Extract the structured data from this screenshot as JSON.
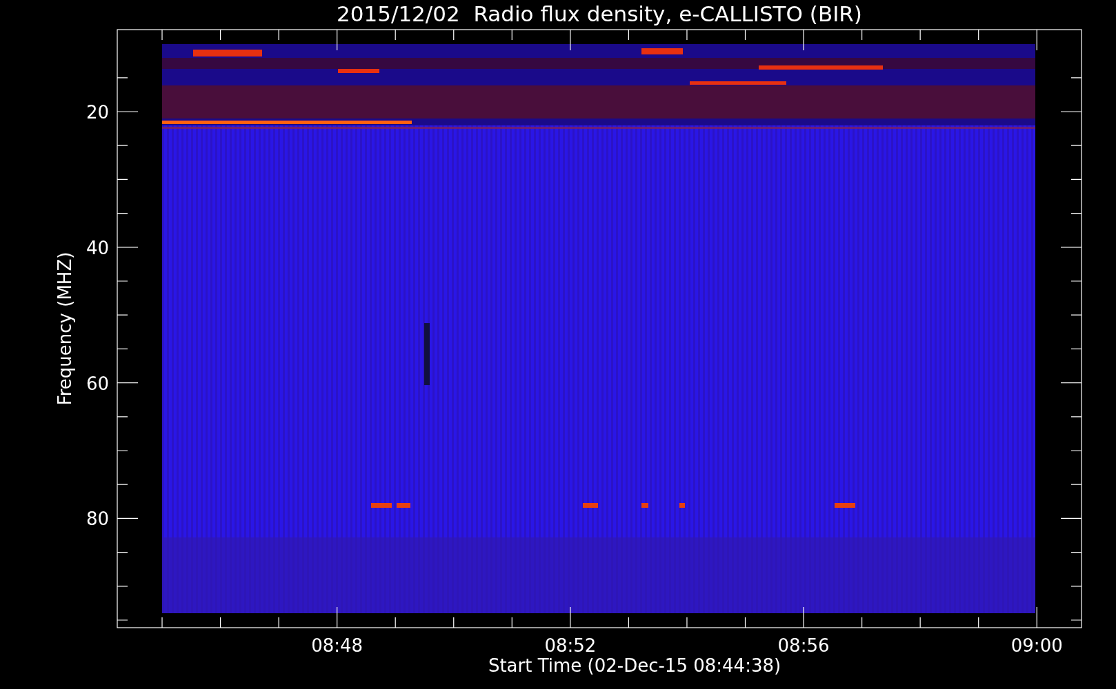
{
  "title": "2015/12/02  Radio flux density, e-CALLISTO (BIR)",
  "y_axis": {
    "label": "Frequency (MHZ)",
    "tick_labels": [
      "20",
      "40",
      "60",
      "80"
    ]
  },
  "x_axis": {
    "label": "Start Time (02-Dec-15 08:44:38)",
    "tick_labels": [
      "08:48",
      "08:52",
      "08:56",
      "09:00"
    ]
  }
}
